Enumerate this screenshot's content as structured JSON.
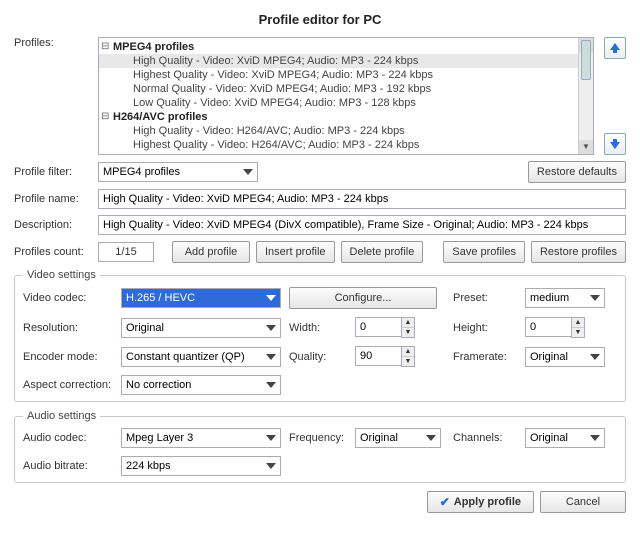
{
  "title": "Profile editor for PC",
  "labels": {
    "profiles": "Profiles:",
    "profile_filter": "Profile filter:",
    "profile_name": "Profile name:",
    "description": "Description:",
    "profiles_count": "Profiles count:",
    "video_settings": "Video settings",
    "audio_settings": "Audio settings",
    "video_codec": "Video codec:",
    "resolution": "Resolution:",
    "encoder_mode": "Encoder mode:",
    "aspect_correction": "Aspect correction:",
    "width": "Width:",
    "quality": "Quality:",
    "preset": "Preset:",
    "height": "Height:",
    "framerate": "Framerate:",
    "audio_codec": "Audio codec:",
    "audio_bitrate": "Audio bitrate:",
    "frequency": "Frequency:",
    "channels": "Channels:"
  },
  "buttons": {
    "restore_defaults": "Restore defaults",
    "add_profile": "Add profile",
    "insert_profile": "Insert profile",
    "delete_profile": "Delete profile",
    "save_profiles": "Save profiles",
    "restore_profiles": "Restore profiles",
    "configure": "Configure...",
    "apply_profile": "Apply profile",
    "cancel": "Cancel"
  },
  "tree": {
    "group1": "MPEG4 profiles",
    "items1": {
      "0": "High Quality - Video: XviD MPEG4; Audio: MP3 - 224 kbps",
      "1": "Highest Quality - Video: XviD MPEG4; Audio: MP3 - 224 kbps",
      "2": "Normal Quality - Video: XviD MPEG4; Audio: MP3 - 192 kbps",
      "3": "Low Quality - Video: XviD MPEG4; Audio: MP3 - 128 kbps"
    },
    "group2": "H264/AVC profiles",
    "items2": {
      "0": "High Quality - Video: H264/AVC; Audio: MP3 - 224 kbps",
      "1": "Highest Quality - Video: H264/AVC; Audio: MP3 - 224 kbps"
    }
  },
  "filter": "MPEG4 profiles",
  "profile_name": "High Quality - Video: XviD MPEG4; Audio: MP3 - 224 kbps",
  "description": "High Quality - Video: XviD MPEG4 (DivX compatible), Frame Size - Original; Audio: MP3 - 224 kbps",
  "profiles_count": "1/15",
  "video": {
    "codec": "H.265 / HEVC",
    "resolution": "Original",
    "encoder_mode": "Constant quantizer (QP)",
    "aspect": "No correction",
    "width": "0",
    "quality": "90",
    "preset": "medium",
    "height": "0",
    "framerate": "Original"
  },
  "audio": {
    "codec": "Mpeg Layer 3",
    "bitrate": "224 kbps",
    "frequency": "Original",
    "channels": "Original"
  }
}
